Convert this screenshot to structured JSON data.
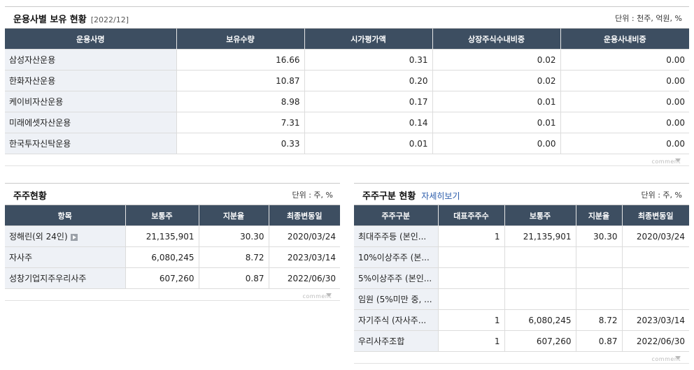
{
  "fund_holdings": {
    "title": "운용사별 보유 현황",
    "date": "[2022/12]",
    "unit": "단위 : 천주, 억원, %",
    "headers": [
      "운용사명",
      "보유수량",
      "시가평가액",
      "상장주식수내비중",
      "운용사내비중"
    ],
    "rows": [
      [
        "삼성자산운용",
        "16.66",
        "0.31",
        "0.02",
        "0.00"
      ],
      [
        "한화자산운용",
        "10.87",
        "0.20",
        "0.02",
        "0.00"
      ],
      [
        "케이비자산운용",
        "8.98",
        "0.17",
        "0.01",
        "0.00"
      ],
      [
        "미래에셋자산운용",
        "7.31",
        "0.14",
        "0.01",
        "0.00"
      ],
      [
        "한국투자신탁운용",
        "0.33",
        "0.01",
        "0.00",
        "0.00"
      ]
    ],
    "comment": "comment"
  },
  "shareholders": {
    "title": "주주현황",
    "unit": "단위 : 주, %",
    "headers": [
      "항목",
      "보통주",
      "지분율",
      "최종변동일"
    ],
    "rows": [
      [
        "정해린(외 24인)",
        "21,135,901",
        "30.30",
        "2020/03/24"
      ],
      [
        "자사주",
        "6,080,245",
        "8.72",
        "2023/03/14"
      ],
      [
        "성창기업지주우리사주",
        "607,260",
        "0.87",
        "2022/06/30"
      ]
    ],
    "comment": "comment"
  },
  "shareholder_types": {
    "title": "주주구분 현황",
    "link": "자세히보기",
    "unit": "단위 : 주, %",
    "headers": [
      "주주구분",
      "대표주주수",
      "보통주",
      "지분율",
      "최종변동일"
    ],
    "rows": [
      [
        "최대주주등 (본인...",
        "1",
        "21,135,901",
        "30.30",
        "2020/03/24"
      ],
      [
        "10%이상주주 (본...",
        "",
        "",
        "",
        ""
      ],
      [
        "5%이상주주 (본인...",
        "",
        "",
        "",
        ""
      ],
      [
        "임원 (5%미만 중, ...",
        "",
        "",
        "",
        ""
      ],
      [
        "자기주식 (자사주...",
        "1",
        "6,080,245",
        "8.72",
        "2023/03/14"
      ],
      [
        "우리사주조합",
        "1",
        "607,260",
        "0.87",
        "2022/06/30"
      ]
    ],
    "comment": "comment"
  },
  "icons": {
    "more": "play-icon",
    "comment_arrow": "triangle-down-icon"
  },
  "colors": {
    "header_bg": "#3d4e61",
    "first_col_bg": "#eef1f6",
    "link": "#2b5cab"
  }
}
